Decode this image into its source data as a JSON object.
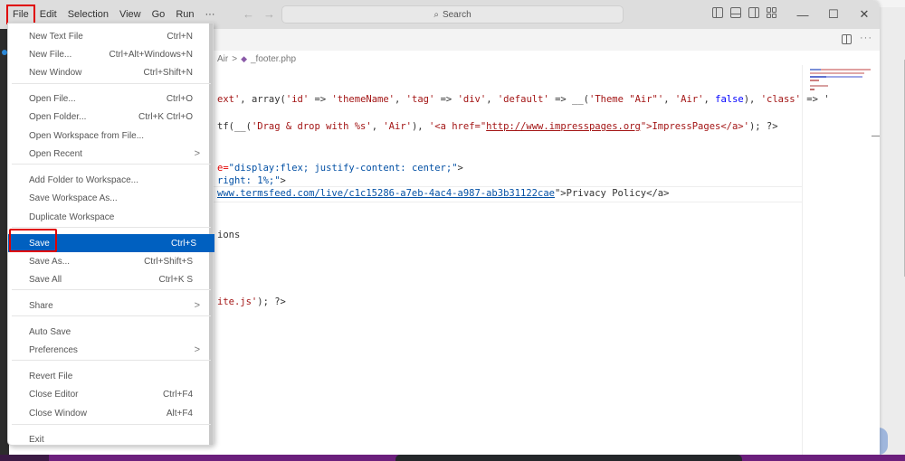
{
  "titlebar": {
    "menu": [
      "File",
      "Edit",
      "Selection",
      "View",
      "Go",
      "Run",
      "···"
    ],
    "active_menu": "File",
    "nav_back": "←",
    "nav_forward": "→",
    "search_placeholder": "Search",
    "search_icon": "⌕",
    "window_controls": {
      "minimize": "—",
      "maximize": "☐",
      "close": "✕"
    }
  },
  "editor": {
    "breadcrumb": [
      "Air",
      ">",
      "_footer.php"
    ],
    "breadcrumb_icon": "php-elephant-icon",
    "more_actions": "···",
    "lines": [
      {
        "parts": [
          {
            "t": "ext'",
            "c": "str"
          },
          {
            "t": ", array(",
            "c": ""
          },
          {
            "t": "'id'",
            "c": "str"
          },
          {
            "t": " => ",
            "c": ""
          },
          {
            "t": "'themeName'",
            "c": "str"
          },
          {
            "t": ", ",
            "c": ""
          },
          {
            "t": "'tag'",
            "c": "str"
          },
          {
            "t": " => ",
            "c": ""
          },
          {
            "t": "'div'",
            "c": "str"
          },
          {
            "t": ", ",
            "c": ""
          },
          {
            "t": "'default'",
            "c": "str"
          },
          {
            "t": " => __(",
            "c": ""
          },
          {
            "t": "'Theme \"Air\"'",
            "c": "str"
          },
          {
            "t": ", ",
            "c": ""
          },
          {
            "t": "'Air'",
            "c": "str"
          },
          {
            "t": ", ",
            "c": ""
          },
          {
            "t": "false",
            "c": "kw"
          },
          {
            "t": "), ",
            "c": ""
          },
          {
            "t": "'class'",
            "c": "str"
          },
          {
            "t": " => '",
            "c": ""
          }
        ]
      },
      {
        "parts": [
          {
            "t": "tf(__(",
            "c": ""
          },
          {
            "t": "'Drag & drop with %s'",
            "c": "str"
          },
          {
            "t": ", ",
            "c": ""
          },
          {
            "t": "'Air'",
            "c": "str"
          },
          {
            "t": "), ",
            "c": ""
          },
          {
            "t": "'<a href=\"",
            "c": "str"
          },
          {
            "t": "http://www.impresspages.org",
            "c": "strlink"
          },
          {
            "t": "\">ImpressPages</a>'",
            "c": "str"
          },
          {
            "t": "); ?>",
            "c": ""
          }
        ]
      },
      {
        "parts": [
          {
            "t": "e=",
            "c": "attr"
          },
          {
            "t": "\"display:flex; justify-content: center;\"",
            "c": "link2"
          },
          {
            "t": ">",
            "c": ""
          }
        ]
      },
      {
        "parts": [
          {
            "t": "right: 1%;\"",
            "c": "link2"
          },
          {
            "t": ">",
            "c": ""
          }
        ]
      },
      {
        "parts": [
          {
            "t": "www.termsfeed.com/live/c1c15286-a7eb-4ac4-a987-ab3b31122cae",
            "c": "link"
          },
          {
            "t": "\">Privacy Policy</a>",
            "c": ""
          }
        ]
      },
      {
        "parts": [
          {
            "t": "ions",
            "c": ""
          }
        ]
      },
      {
        "parts": [
          {
            "t": "ite.js'",
            "c": "str"
          },
          {
            "t": "); ?>",
            "c": ""
          }
        ]
      }
    ]
  },
  "file_menu": {
    "items": [
      {
        "label": "New Text File",
        "shortcut": "Ctrl+N"
      },
      {
        "label": "New File...",
        "shortcut": "Ctrl+Alt+Windows+N"
      },
      {
        "label": "New Window",
        "shortcut": "Ctrl+Shift+N"
      },
      {
        "label": "Open File...",
        "shortcut": "Ctrl+O"
      },
      {
        "label": "Open Folder...",
        "shortcut": "Ctrl+K Ctrl+O"
      },
      {
        "label": "Open Workspace from File...",
        "shortcut": ""
      },
      {
        "label": "Open Recent",
        "shortcut": "",
        "submenu": ">"
      },
      {
        "label": "Add Folder to Workspace...",
        "shortcut": ""
      },
      {
        "label": "Save Workspace As...",
        "shortcut": ""
      },
      {
        "label": "Duplicate Workspace",
        "shortcut": ""
      },
      {
        "label": "Save",
        "shortcut": "Ctrl+S",
        "selected": true
      },
      {
        "label": "Save As...",
        "shortcut": "Ctrl+Shift+S"
      },
      {
        "label": "Save All",
        "shortcut": "Ctrl+K S"
      },
      {
        "label": "Share",
        "shortcut": "",
        "submenu": ">"
      },
      {
        "label": "Auto Save",
        "shortcut": ""
      },
      {
        "label": "Preferences",
        "shortcut": "",
        "submenu": ">"
      },
      {
        "label": "Revert File",
        "shortcut": ""
      },
      {
        "label": "Close Editor",
        "shortcut": "Ctrl+F4"
      },
      {
        "label": "Close Window",
        "shortcut": "Alt+F4"
      },
      {
        "label": "Exit",
        "shortcut": ""
      }
    ]
  },
  "colors": {
    "highlight_red": "#e00000",
    "selection_blue": "#0060c0",
    "taskbar_purple": "#6b1f7c"
  }
}
